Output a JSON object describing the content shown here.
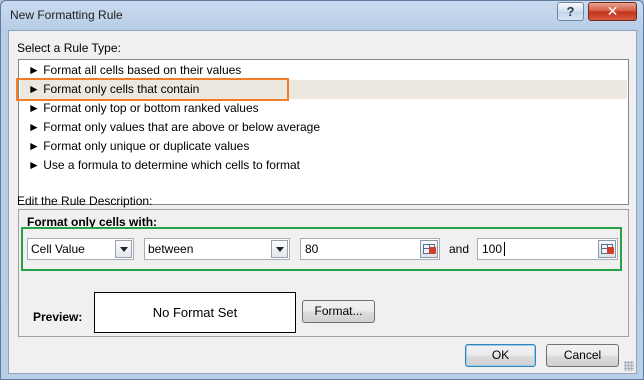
{
  "window": {
    "title": "New Formatting Rule"
  },
  "titlebar_buttons": {
    "help": "?",
    "close": "✕"
  },
  "rule_type": {
    "label": "Select a Rule Type:",
    "items": [
      "► Format all cells based on their values",
      "► Format only cells that contain",
      "► Format only top or bottom ranked values",
      "► Format only values that are above or below average",
      "► Format only unique or duplicate values",
      "► Use a formula to determine which cells to format"
    ],
    "selected_index": 1
  },
  "description": {
    "label": "Edit the Rule Description:",
    "heading": "Format only cells with:",
    "condition_type": "Cell Value",
    "operator": "between",
    "value1": "80",
    "and_label": "and",
    "value2": "100",
    "preview_label": "Preview:",
    "preview_text": "No Format Set",
    "format_button": "Format..."
  },
  "buttons": {
    "ok": "OK",
    "cancel": "Cancel"
  },
  "colors": {
    "highlight_orange": "#f07d2a",
    "highlight_green": "#27a04a"
  }
}
